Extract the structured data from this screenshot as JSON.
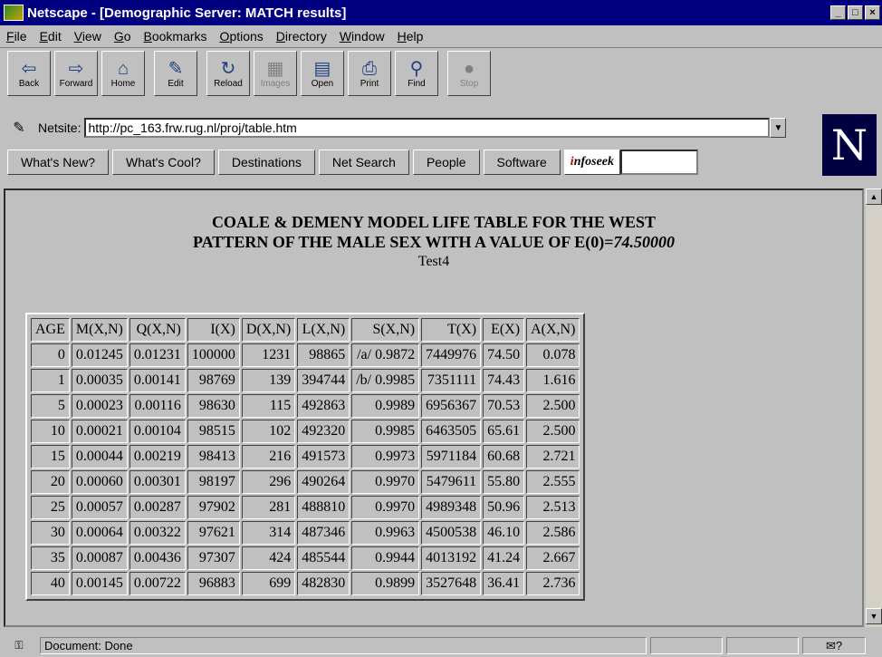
{
  "window": {
    "title": "Netscape - [Demographic Server: MATCH results]"
  },
  "menu": [
    "File",
    "Edit",
    "View",
    "Go",
    "Bookmarks",
    "Options",
    "Directory",
    "Window",
    "Help"
  ],
  "toolbar": [
    {
      "label": "Back",
      "icon": "back-icon",
      "glyph": "⇦"
    },
    {
      "label": "Forward",
      "icon": "forward-icon",
      "glyph": "⇨"
    },
    {
      "label": "Home",
      "icon": "home-icon",
      "glyph": "⌂"
    },
    {
      "label": "Edit",
      "icon": "edit-icon",
      "glyph": "✎"
    },
    {
      "label": "Reload",
      "icon": "reload-icon",
      "glyph": "↻"
    },
    {
      "label": "Images",
      "icon": "images-icon",
      "glyph": "▦"
    },
    {
      "label": "Open",
      "icon": "open-icon",
      "glyph": "▤"
    },
    {
      "label": "Print",
      "icon": "print-icon",
      "glyph": "⎙"
    },
    {
      "label": "Find",
      "icon": "find-icon",
      "glyph": "⚲"
    },
    {
      "label": "Stop",
      "icon": "stop-icon",
      "glyph": "●"
    }
  ],
  "location": {
    "label": "Netsite:",
    "url": "http://pc_163.frw.rug.nl/proj/table.htm"
  },
  "directory_buttons": [
    "What's New?",
    "What's Cool?",
    "Destinations",
    "Net Search",
    "People",
    "Software"
  ],
  "infoseek": "infoseek",
  "page": {
    "heading_line1": "COALE & DEMENY MODEL LIFE TABLE FOR THE WEST",
    "heading_line2": "PATTERN OF THE MALE SEX WITH A VALUE OF E(0)=",
    "heading_value": "74.50000",
    "subheading": "Test4"
  },
  "table": {
    "headers": [
      "AGE",
      "M(X,N)",
      "Q(X,N)",
      "I(X)",
      "D(X,N)",
      "L(X,N)",
      "S(X,N)",
      "T(X)",
      "E(X)",
      "A(X,N)"
    ],
    "rows": [
      [
        "0",
        "0.01245",
        "0.01231",
        "100000",
        "1231",
        "98865",
        "/a/ 0.9872",
        "7449976",
        "74.50",
        "0.078"
      ],
      [
        "1",
        "0.00035",
        "0.00141",
        "98769",
        "139",
        "394744",
        "/b/ 0.9985",
        "7351111",
        "74.43",
        "1.616"
      ],
      [
        "5",
        "0.00023",
        "0.00116",
        "98630",
        "115",
        "492863",
        "0.9989",
        "6956367",
        "70.53",
        "2.500"
      ],
      [
        "10",
        "0.00021",
        "0.00104",
        "98515",
        "102",
        "492320",
        "0.9985",
        "6463505",
        "65.61",
        "2.500"
      ],
      [
        "15",
        "0.00044",
        "0.00219",
        "98413",
        "216",
        "491573",
        "0.9973",
        "5971184",
        "60.68",
        "2.721"
      ],
      [
        "20",
        "0.00060",
        "0.00301",
        "98197",
        "296",
        "490264",
        "0.9970",
        "5479611",
        "55.80",
        "2.555"
      ],
      [
        "25",
        "0.00057",
        "0.00287",
        "97902",
        "281",
        "488810",
        "0.9970",
        "4989348",
        "50.96",
        "2.513"
      ],
      [
        "30",
        "0.00064",
        "0.00322",
        "97621",
        "314",
        "487346",
        "0.9963",
        "4500538",
        "46.10",
        "2.586"
      ],
      [
        "35",
        "0.00087",
        "0.00436",
        "97307",
        "424",
        "485544",
        "0.9944",
        "4013192",
        "41.24",
        "2.667"
      ],
      [
        "40",
        "0.00145",
        "0.00722",
        "96883",
        "699",
        "482830",
        "0.9899",
        "3527648",
        "36.41",
        "2.736"
      ]
    ]
  },
  "status": {
    "text": "Document: Done"
  }
}
